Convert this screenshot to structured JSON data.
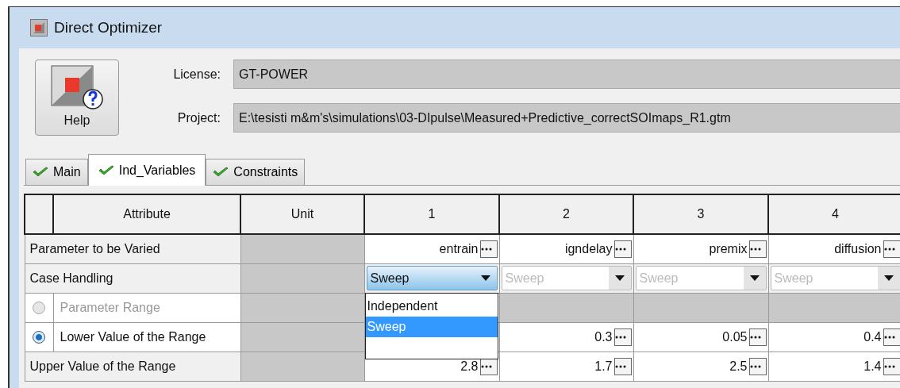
{
  "window": {
    "title": "Direct Optimizer"
  },
  "help_button": {
    "label": "Help"
  },
  "license": {
    "label": "License:",
    "value": "GT-POWER"
  },
  "project": {
    "label": "Project:",
    "value": "E:\\tesisti m&m's\\simulations\\03-DIpulse\\Measured+Predictive_correctSOImaps_R1.gtm"
  },
  "tabs": [
    {
      "label": "Main",
      "selected": false
    },
    {
      "label": "Ind_Variables",
      "selected": true
    },
    {
      "label": "Constraints",
      "selected": false
    }
  ],
  "table": {
    "columns": [
      "Attribute",
      "Unit"
    ],
    "case_columns": [
      "1",
      "2",
      "3",
      "4"
    ],
    "rows": [
      {
        "kind": "text",
        "attribute": "Parameter to be Varied",
        "cells": [
          {
            "value": "entrain"
          },
          {
            "value": "igndelay"
          },
          {
            "value": "premix"
          },
          {
            "value": "diffusion"
          }
        ]
      },
      {
        "kind": "select",
        "attribute": "Case Handling",
        "cells": [
          {
            "value": "Sweep",
            "disabled": false,
            "expanded": true,
            "options": [
              {
                "label": "Independent",
                "selected": false
              },
              {
                "label": "Sweep",
                "selected": true
              }
            ]
          },
          {
            "value": "Sweep",
            "disabled": true
          },
          {
            "value": "Sweep",
            "disabled": true
          },
          {
            "value": "Sweep",
            "disabled": true
          }
        ]
      },
      {
        "kind": "option",
        "attribute": "Parameter Range",
        "selected": false,
        "disabled": true,
        "cells": [
          null,
          {},
          {},
          {}
        ]
      },
      {
        "kind": "option",
        "attribute": "Lower Value of the Range",
        "selected": true,
        "cells": [
          null,
          {
            "value": "0.3"
          },
          {
            "value": "0.05"
          },
          {
            "value": "0.4"
          }
        ]
      },
      {
        "kind": "text",
        "attribute": "Upper Value of the Range",
        "cells": [
          {
            "value": "2.8"
          },
          {
            "value": "1.7"
          },
          {
            "value": "2.5"
          },
          {
            "value": "1.4"
          }
        ]
      }
    ]
  }
}
